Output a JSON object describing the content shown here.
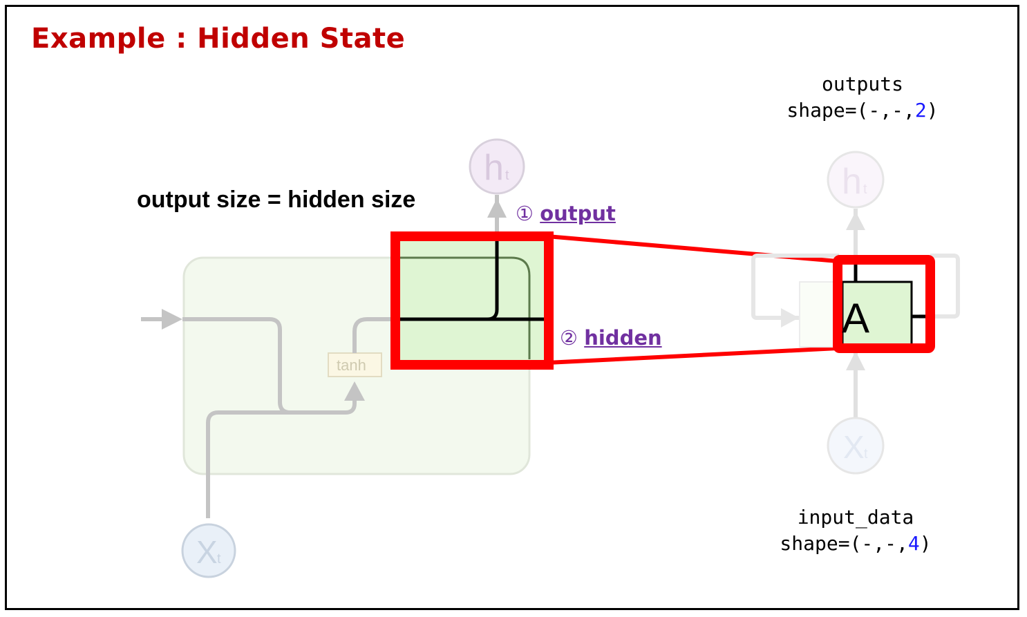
{
  "title": "Example : Hidden State",
  "caption": "output size = hidden size",
  "outputs": {
    "label": "outputs",
    "shape_prefix": "shape=(-,-,",
    "shape_value": "2",
    "shape_suffix": ")"
  },
  "input_data": {
    "label": "input_data",
    "shape_prefix": "shape=(-,-,",
    "shape_value": "4",
    "shape_suffix": ")"
  },
  "callouts": {
    "output": {
      "marker": "①",
      "label": "output"
    },
    "hidden": {
      "marker": "②",
      "label": "hidden"
    }
  },
  "nodes": {
    "h_letter": "h",
    "h_sub": "t",
    "x_letter": "X",
    "x_sub": "t",
    "tanh": "tanh",
    "cell": "A"
  },
  "colors": {
    "title": "#c00000",
    "highlight": "#ff0000",
    "callout": "#7030a0",
    "number": "#1a1aff",
    "cell_fill": "#dff5d3"
  }
}
